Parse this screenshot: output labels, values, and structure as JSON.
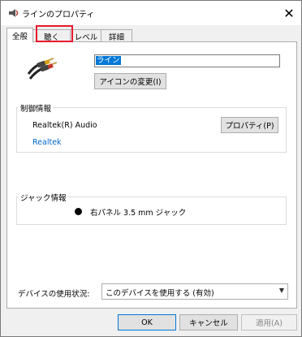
{
  "window": {
    "title": "ラインのプロパティ",
    "close_glyph": "✕"
  },
  "tabs": [
    {
      "label": "全般"
    },
    {
      "label": "聴く"
    },
    {
      "label": "レベル"
    },
    {
      "label": "詳細"
    }
  ],
  "device": {
    "name_value": "ライン",
    "change_icon_label": "アイコンの変更(I)"
  },
  "controller": {
    "group_label": "制御情報",
    "device_name": "Realtek(R) Audio",
    "properties_label": "プロパティ(P)",
    "vendor_link": "Realtek"
  },
  "jack": {
    "group_label": "ジャック情報",
    "jack_text": "右パネル 3.5 mm ジャック"
  },
  "usage": {
    "label": "デバイスの使用状況:",
    "selected": "このデバイスを使用する (有効)"
  },
  "footer": {
    "ok_label": "OK",
    "cancel_label": "キャンセル",
    "apply_label": "適用(A)"
  },
  "colors": {
    "highlight": "#e8192c",
    "link": "#0066cc",
    "selection": "#0078d7"
  }
}
